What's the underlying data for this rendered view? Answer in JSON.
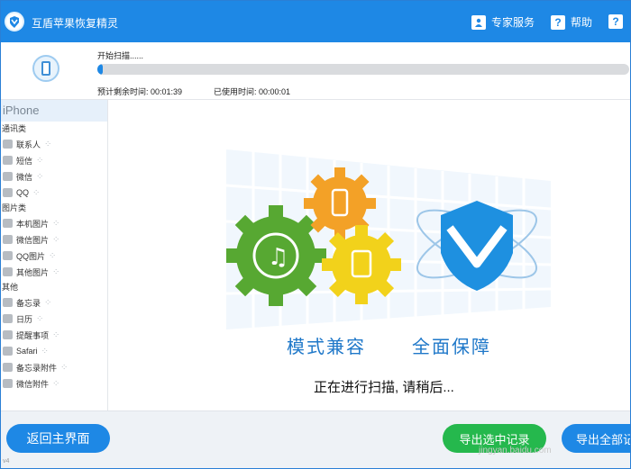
{
  "app": {
    "title": "互盾苹果恢复精灵",
    "expert_service": "专家服务",
    "help": "帮助",
    "more": "?",
    "accent_color": "#1e88e5",
    "export_color": "#25b84d"
  },
  "scan": {
    "status_text": "开始扫描......",
    "progress_fraction": 0.01,
    "estimated_label": "预计剩余时间:",
    "estimated_value": "00:01:39",
    "used_label": "已使用时间:",
    "used_value": "00:00:01"
  },
  "sidebar": {
    "device": "iPhone",
    "groups": [
      {
        "label": "通讯类",
        "items": [
          {
            "label": "联系人",
            "icon": "contact-icon"
          },
          {
            "label": "短信",
            "icon": "sms-icon"
          },
          {
            "label": "微信",
            "icon": "wechat-icon"
          },
          {
            "label": "QQ",
            "icon": "qq-icon"
          }
        ]
      },
      {
        "label": "图片类",
        "items": [
          {
            "label": "本机图片",
            "icon": "photo-icon"
          },
          {
            "label": "微信图片",
            "icon": "photo-icon"
          },
          {
            "label": "QQ图片",
            "icon": "photo-icon"
          },
          {
            "label": "其他图片",
            "icon": "photo-icon"
          }
        ]
      },
      {
        "label": "其他",
        "items": [
          {
            "label": "备忘录",
            "icon": "notes-icon"
          },
          {
            "label": "日历",
            "icon": "calendar-icon"
          },
          {
            "label": "提醒事项",
            "icon": "reminder-icon"
          },
          {
            "label": "Safari",
            "icon": "safari-icon"
          },
          {
            "label": "备忘录附件",
            "icon": "attachment-icon"
          },
          {
            "label": "微信附件",
            "icon": "attachment-icon"
          }
        ]
      }
    ]
  },
  "main": {
    "slogan_left": "模式兼容",
    "slogan_right": "全面保障",
    "status": "正在进行扫描, 请稍后..."
  },
  "footer": {
    "home": "返回主界面",
    "export_selected": "导出选中记录",
    "export_all": "导出全部记",
    "watermark": "jingyan.baidu.com",
    "version": "v4"
  }
}
